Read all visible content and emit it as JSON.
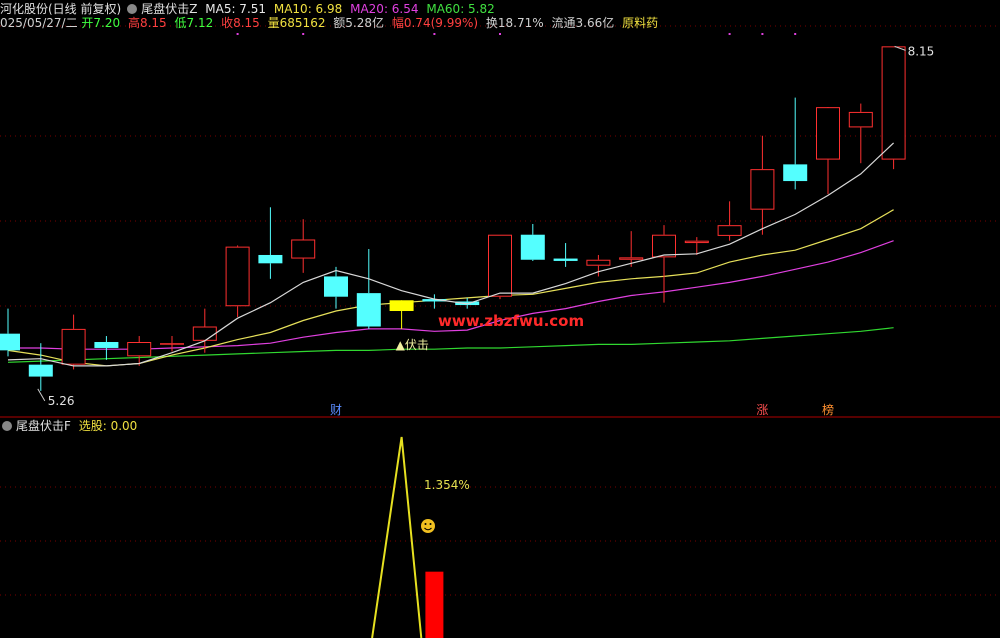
{
  "header": {
    "stock_name": "河化股份(日线 前复权)",
    "indicator_name": "尾盘伏击Z",
    "ma5": "MA5: 7.51",
    "ma10": "MA10: 6.98",
    "ma20": "MA20: 6.54",
    "ma60": "MA60: 5.82"
  },
  "quote": {
    "date": "025/05/27/二",
    "open": "开7.20",
    "high": "高8.15",
    "low": "低7.12",
    "close": "收8.15",
    "volume": "量685162",
    "amount": "额5.28亿",
    "change": "幅0.74(9.99%)",
    "turnover": "换18.71%",
    "float": "流通3.66亿",
    "sector": "原料药"
  },
  "sub_header": {
    "indicator_name": "尾盘伏击F",
    "select_label": "选股: 0.00"
  },
  "colors": {
    "up": "#ff3030",
    "down": "#54ffff",
    "ma5": "#d8d8d8",
    "ma10": "#e6e05a",
    "ma20": "#e040e0",
    "ma60": "#30d830",
    "signal_candle": "#ffff00",
    "grid": "#7a0000",
    "watermark": "#ff2a2a"
  },
  "chart_data": [
    {
      "type": "candlestick",
      "candles": [
        {
          "o": 5.74,
          "h": 5.95,
          "l": 5.55,
          "c": 5.6
        },
        {
          "o": 5.48,
          "h": 5.66,
          "l": 5.26,
          "c": 5.38
        },
        {
          "o": 5.48,
          "h": 5.9,
          "l": 5.44,
          "c": 5.78
        },
        {
          "o": 5.67,
          "h": 5.72,
          "l": 5.52,
          "c": 5.62
        },
        {
          "o": 5.55,
          "h": 5.72,
          "l": 5.47,
          "c": 5.67
        },
        {
          "o": 5.65,
          "h": 5.72,
          "l": 5.59,
          "c": 5.66
        },
        {
          "o": 5.68,
          "h": 5.95,
          "l": 5.58,
          "c": 5.8
        },
        {
          "o": 5.97,
          "h": 6.48,
          "l": 5.88,
          "c": 6.47
        },
        {
          "o": 6.4,
          "h": 6.8,
          "l": 6.2,
          "c": 6.33
        },
        {
          "o": 6.37,
          "h": 6.7,
          "l": 6.25,
          "c": 6.53
        },
        {
          "o": 6.22,
          "h": 6.3,
          "l": 5.95,
          "c": 6.05
        },
        {
          "o": 6.08,
          "h": 6.45,
          "l": 5.78,
          "c": 5.8
        },
        {
          "o": 5.93,
          "h": 6.0,
          "l": 5.78,
          "c": 6.02
        },
        {
          "o": 6.03,
          "h": 6.07,
          "l": 5.95,
          "c": 6.01
        },
        {
          "o": 6.01,
          "h": 6.04,
          "l": 5.95,
          "c": 5.98
        },
        {
          "o": 6.05,
          "h": 6.57,
          "l": 6.03,
          "c": 6.57
        },
        {
          "o": 6.57,
          "h": 6.66,
          "l": 6.35,
          "c": 6.36
        },
        {
          "o": 6.37,
          "h": 6.5,
          "l": 6.3,
          "c": 6.35
        },
        {
          "o": 6.31,
          "h": 6.4,
          "l": 6.22,
          "c": 6.36
        },
        {
          "o": 6.36,
          "h": 6.6,
          "l": 6.3,
          "c": 6.38
        },
        {
          "o": 6.38,
          "h": 6.65,
          "l": 6.0,
          "c": 6.57
        },
        {
          "o": 6.5,
          "h": 6.55,
          "l": 6.4,
          "c": 6.52
        },
        {
          "o": 6.56,
          "h": 6.85,
          "l": 6.52,
          "c": 6.65
        },
        {
          "o": 6.78,
          "h": 7.4,
          "l": 6.57,
          "c": 7.12
        },
        {
          "o": 7.16,
          "h": 7.72,
          "l": 6.95,
          "c": 7.02
        },
        {
          "o": 7.2,
          "h": 7.57,
          "l": 6.91,
          "c": 7.64
        },
        {
          "o": 7.47,
          "h": 7.67,
          "l": 7.17,
          "c": 7.6
        },
        {
          "o": 7.2,
          "h": 8.15,
          "l": 7.12,
          "c": 8.15
        }
      ],
      "ma5": [
        5.52,
        5.53,
        5.47,
        5.47,
        5.49,
        5.58,
        5.68,
        5.87,
        6.0,
        6.17,
        6.27,
        6.2,
        6.1,
        6.03,
        5.99,
        6.08,
        6.08,
        6.16,
        6.26,
        6.33,
        6.4,
        6.41,
        6.49,
        6.62,
        6.74,
        6.9,
        7.08,
        7.34
      ],
      "ma10": [
        5.6,
        5.56,
        5.5,
        5.47,
        5.49,
        5.56,
        5.62,
        5.69,
        5.75,
        5.85,
        5.93,
        5.98,
        6.0,
        6.02,
        6.04,
        6.06,
        6.07,
        6.12,
        6.17,
        6.2,
        6.22,
        6.25,
        6.34,
        6.4,
        6.44,
        6.53,
        6.62,
        6.78
      ],
      "ma20": [
        5.62,
        5.62,
        5.61,
        5.61,
        5.61,
        5.62,
        5.63,
        5.64,
        5.66,
        5.71,
        5.75,
        5.78,
        5.78,
        5.76,
        5.77,
        5.85,
        5.91,
        5.95,
        6.01,
        6.06,
        6.09,
        6.13,
        6.17,
        6.22,
        6.28,
        6.34,
        6.42,
        6.52
      ],
      "ma60": [
        5.5,
        5.51,
        5.52,
        5.53,
        5.54,
        5.55,
        5.56,
        5.57,
        5.58,
        5.59,
        5.6,
        5.6,
        5.61,
        5.61,
        5.62,
        5.62,
        5.63,
        5.64,
        5.65,
        5.65,
        5.66,
        5.67,
        5.68,
        5.7,
        5.72,
        5.74,
        5.76,
        5.79
      ],
      "signal_index": 12,
      "signal_label": "▲伏击",
      "high_label": "8.15",
      "low_label": "5.26",
      "event_markers": [
        {
          "index": 10,
          "text": "财",
          "color": "#5a8cff"
        },
        {
          "index": 23,
          "text": "涨",
          "color": "#ff5050"
        },
        {
          "index": 25,
          "text": "榜",
          "color": "#ff9030"
        }
      ],
      "watermark": "www.zbzfwu.com",
      "ylim": [
        5.15,
        8.22
      ]
    },
    {
      "type": "line",
      "name": "尾盘伏击F",
      "points": [
        {
          "index": 11.1,
          "value": 0
        },
        {
          "index": 12,
          "value": 1
        },
        {
          "index": 12.6,
          "value": 0
        }
      ],
      "bar": {
        "index": 13,
        "value": 0.33,
        "color": "#ff0000"
      },
      "annotation": "1.354%",
      "annotation_icon": "smiley-icon"
    }
  ]
}
